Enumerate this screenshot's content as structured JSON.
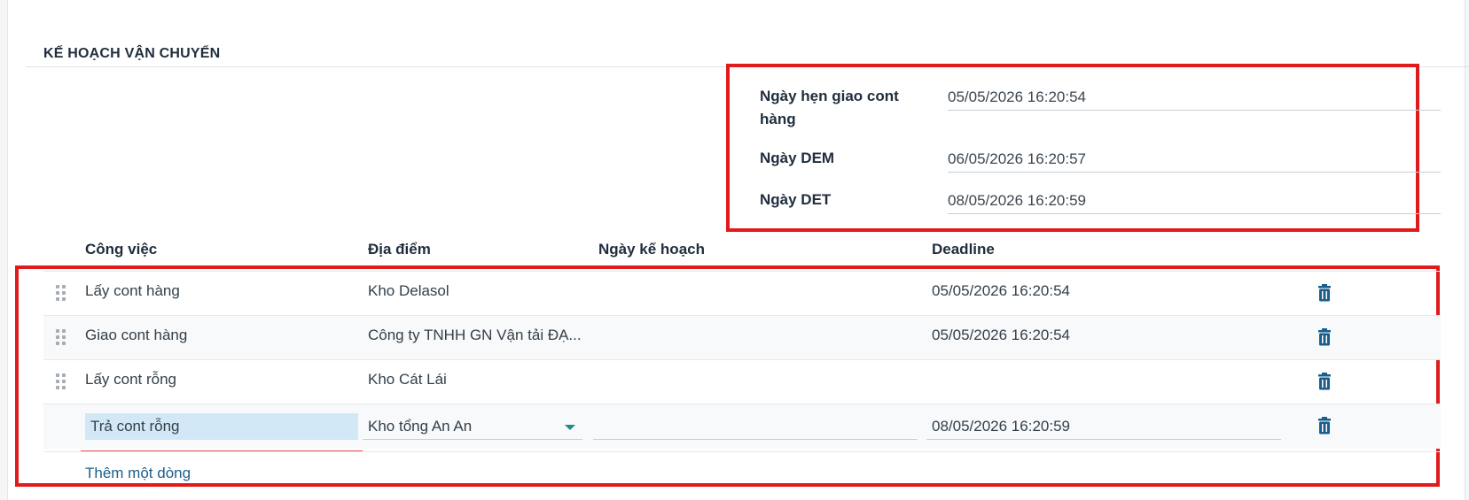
{
  "section": {
    "title": "KẾ HOẠCH VẬN CHUYỂN"
  },
  "dates": {
    "appointment_label": "Ngày hẹn giao cont hàng",
    "appointment_value": "05/05/2026 16:20:54",
    "dem_label": "Ngày DEM",
    "dem_value": "06/05/2026 16:20:57",
    "det_label": "Ngày DET",
    "det_value": "08/05/2026 16:20:59"
  },
  "table": {
    "columns": [
      "Công việc",
      "Địa điểm",
      "Ngày kế hoạch",
      "Deadline"
    ],
    "rows": [
      {
        "task": "Lấy cont hàng",
        "location": "Kho Delasol",
        "planned_date": "",
        "deadline": "05/05/2026 16:20:54"
      },
      {
        "task": "Giao cont hàng",
        "location": "Công ty TNHH GN Vận tải ĐẠ...",
        "planned_date": "",
        "deadline": "05/05/2026 16:20:54"
      },
      {
        "task": "Lấy cont rỗng",
        "location": "Kho Cát Lái",
        "planned_date": "",
        "deadline": ""
      },
      {
        "task": "Trả cont rỗng",
        "location": "Kho tổng An An",
        "planned_date": "",
        "deadline": "08/05/2026 16:20:59"
      }
    ],
    "add_line_label": "Thêm một dòng"
  },
  "icons": {
    "drag": "drag-handle-icon",
    "delete": "trash-icon",
    "dropdown": "caret-down-icon"
  },
  "colors": {
    "highlight_border": "#e01b1b",
    "link": "#1b5e8c",
    "trash": "#1b5e8c",
    "active_input_bg": "#d3e8f7"
  }
}
